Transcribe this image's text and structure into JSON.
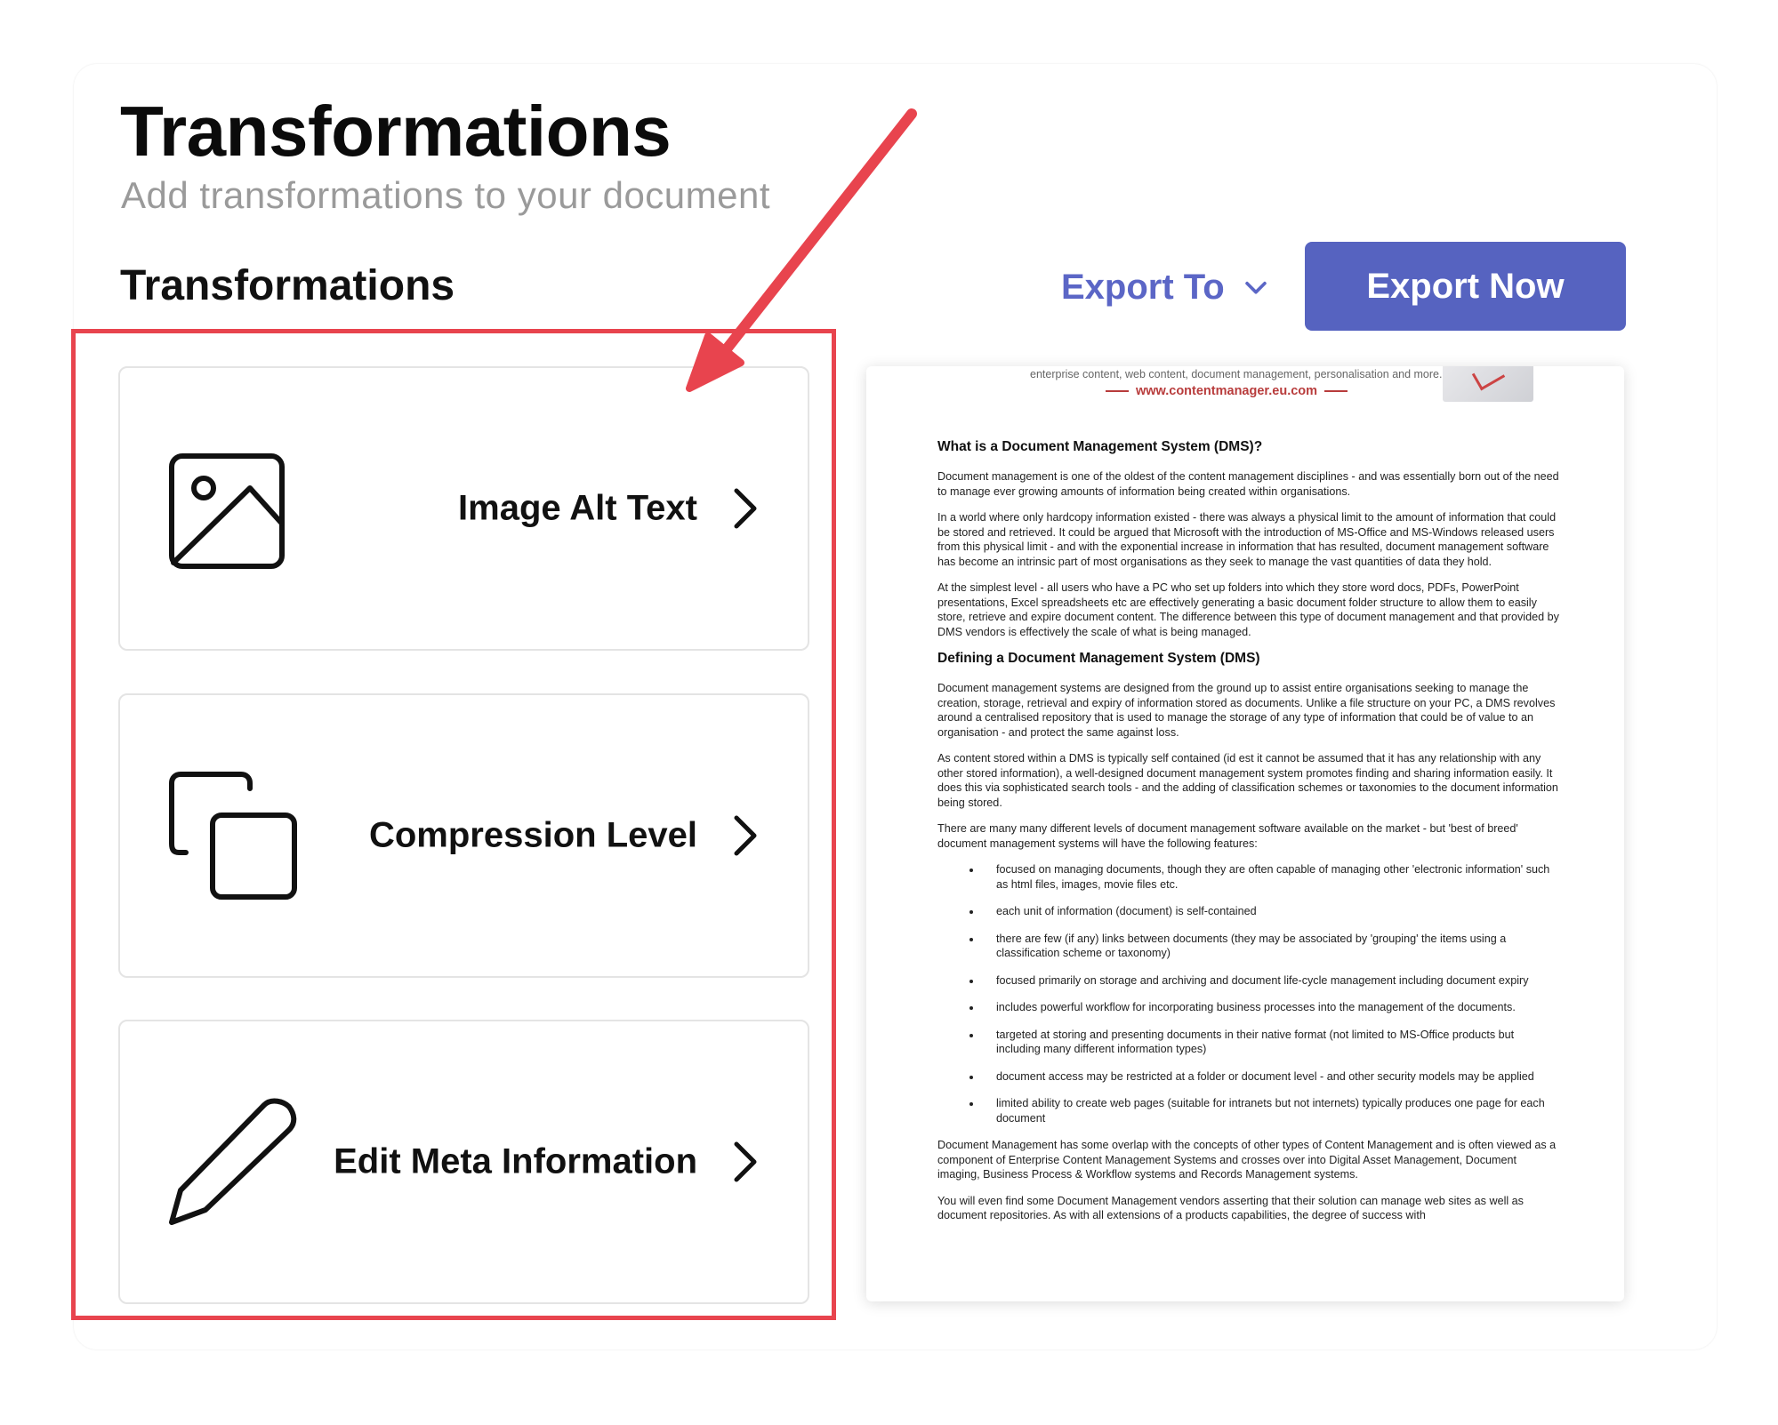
{
  "header": {
    "title": "Transformations",
    "subtitle": "Add transformations to your document"
  },
  "section": {
    "heading": "Transformations"
  },
  "toolbar": {
    "export_to_label": "Export To",
    "export_now_label": "Export Now"
  },
  "transformations": [
    {
      "label": "Image Alt Text",
      "icon": "image-icon"
    },
    {
      "label": "Compression Level",
      "icon": "copy-icon"
    },
    {
      "label": "Edit Meta Information",
      "icon": "pencil-icon"
    }
  ],
  "preview": {
    "tagline": "enterprise content, web content, document management, personalisation and more...",
    "url": "www.contentmanager.eu.com",
    "heading1": "What is a Document Management System (DMS)?",
    "p1": "Document management is one of the oldest of the content management disciplines - and was essentially born out of the need to manage ever growing amounts of information being created within organisations.",
    "p2": "In a world where only hardcopy information existed - there was always a physical limit to the amount of information that could be stored and retrieved. It could be argued that Microsoft with the introduction of MS-Office and MS-Windows released users from this physical limit - and with the exponential increase in information that has resulted, document management software has become an intrinsic part of most organisations as they seek to manage the vast quantities of data they hold.",
    "p3": "At the simplest level - all users who have a PC who set up folders into which they store word docs, PDFs, PowerPoint presentations, Excel spreadsheets etc are effectively generating a basic document folder structure to allow them to easily store, retrieve and expire document content. The difference between this type of document management and that provided by DMS vendors is effectively the scale of what is being managed.",
    "heading2": "Defining a Document Management System (DMS)",
    "p4": "Document management systems are designed from the ground up to assist entire organisations seeking to manage the creation, storage, retrieval and expiry of information stored as documents. Unlike a file structure on your PC, a DMS revolves around a centralised repository that is used to manage the storage of any type of information that could be of value to an organisation - and protect the same against loss.",
    "p5": "As content stored within a DMS is typically self contained (id est it cannot be assumed that it has any relationship with any other stored information), a well-designed document management system promotes finding and sharing information easily. It does this via sophisticated search tools - and the adding of classification schemes or taxonomies to the document information being stored.",
    "p6": "There are many many different levels of document management software available on the market - but 'best of breed' document management systems will have the following features:",
    "bullets": [
      "focused on managing documents, though they are often capable of managing other 'electronic information' such as html files, images, movie files etc.",
      "each unit of information (document) is self-contained",
      "there are few (if any) links between documents (they may be associated by 'grouping' the items using a classification scheme or taxonomy)",
      "focused primarily on storage and archiving and document life-cycle management including document expiry",
      "includes powerful workflow for incorporating business processes into the management of the documents.",
      "targeted at storing and presenting documents in their native format (not limited to MS-Office products but including many different information types)",
      "document access may be restricted at a folder or document level - and other security models may be applied",
      "limited ability to create web pages (suitable for intranets but not internets) typically produces one page for each document"
    ],
    "p7": "Document Management has some overlap with the concepts of other types of Content Management and is often viewed as a component of Enterprise Content Management Systems and crosses over into Digital Asset Management, Document imaging, Business Process & Workflow systems and Records Management systems.",
    "p8": "You will even find some Document Management vendors asserting that their solution can manage web sites as well as document repositories. As with all extensions of a products capabilities, the degree of success with"
  },
  "colors": {
    "accent": "#5663c0",
    "accent_text": "#5b66c6",
    "highlight": "#e8444e"
  }
}
